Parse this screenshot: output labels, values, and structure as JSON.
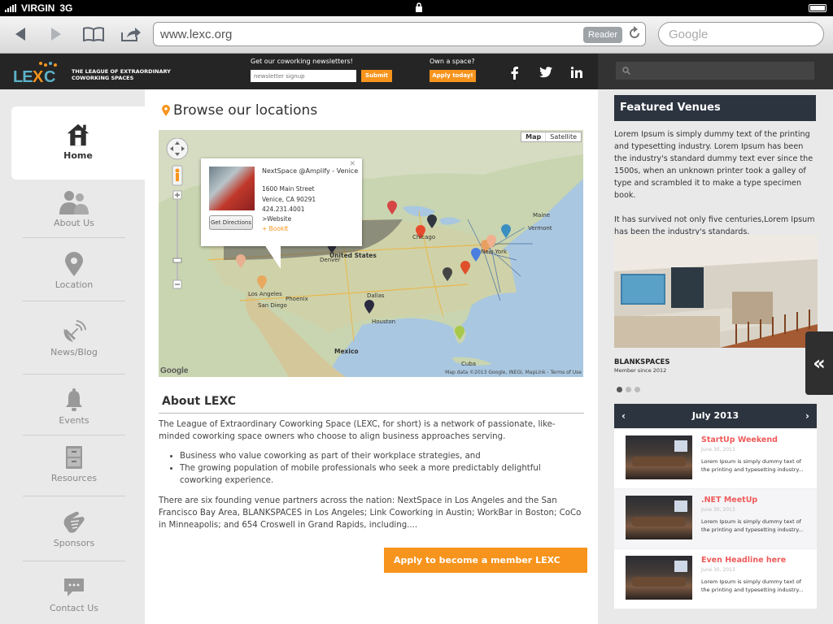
{
  "status": {
    "carrier": "VIRGIN",
    "network": "3G"
  },
  "browser": {
    "url": "www.lexc.org",
    "reader": "Reader",
    "search_placeholder": "Google"
  },
  "header": {
    "logo": "LEXC",
    "tagline": "THE LEAGUE OF EXTRAORDINARY COWORKING SPACES",
    "newsletter_label": "Get our coworking newsletters!",
    "newsletter_placeholder": "newsletter signup",
    "submit": "Submit",
    "own_label": "Own a space?",
    "apply_today": "Apply today!",
    "social": [
      "f",
      "twitter",
      "in"
    ]
  },
  "sidebar": {
    "items": [
      {
        "label": "Home",
        "icon": "home-icon"
      },
      {
        "label": "About Us",
        "icon": "people-icon"
      },
      {
        "label": "Location",
        "icon": "location-pin-icon"
      },
      {
        "label": "News/Blog",
        "icon": "satellite-dish-icon"
      },
      {
        "label": "Events",
        "icon": "bell-icon"
      },
      {
        "label": "Resources",
        "icon": "cabinet-icon"
      },
      {
        "label": "Sponsors",
        "icon": "handshake-icon"
      },
      {
        "label": "Contact Us",
        "icon": "chat-bubble-icon"
      }
    ]
  },
  "main": {
    "title": "Browse our locations",
    "map": {
      "type_map": "Map",
      "type_satellite": "Satellite",
      "google": "Google",
      "copyright": "Map data ©2013 Google, INEGI, MapLink - Terms of Use",
      "popup": {
        "name": "NextSpace @Amplify - Venice",
        "street": "1600 Main Street",
        "city": "Venice, CA 90291",
        "phone": "424.231.4001",
        "website": ">Website",
        "bookit": "+ BookIt",
        "directions": "Get Directions"
      },
      "labels": [
        "United States",
        "Mexico",
        "Cuba",
        "Chicago",
        "New York",
        "Houston",
        "Dallas",
        "Phoenix",
        "Denver",
        "Los Angeles",
        "San Diego",
        "Vermont",
        "Maine"
      ]
    },
    "about": {
      "title": "About LEXC",
      "p1": "The League of Extraordinary Coworking Space (LEXC, for short) is a network of passionate, like-minded coworking space owners who choose to align business approaches serving.",
      "bullets": [
        "Business who value coworking as part of their workplace strategies, and",
        "The growing population of mobile professionals who seek a more predictably delightful coworking experience."
      ],
      "p2": "There are six founding venue partners across the nation: NextSpace in Los Angeles and the San Francisco  Bay Area, BLANKSPACES in Los Angeles; Link Coworking in Austin; WorkBar in Boston; CoCo in Minneapolis; and 654  Croswell in Grand Rapids, including....",
      "apply_button": "Apply to become a member LEXC space"
    }
  },
  "right": {
    "featured_title": "Featured Venues",
    "featured_p1": "Lorem Ipsum is simply dummy text of the printing and typesetting industry. Lorem Ipsum has been the industry's standard dummy text ever since the 1500s, when an unknown printer took a galley of type and scrambled it to make a type specimen book.",
    "featured_p2": "It has survived not only five centuries,Lorem Ipsum has been the industry's standards.",
    "venue_name": "BLANKSPACES",
    "venue_since": "Member since 2012",
    "calendar_month": "July 2013",
    "events": [
      {
        "title": "StartUp Weekend",
        "date": "June 30, 2013",
        "text": "Lorem Ipsum is simply dummy text of the printing and typesetting industry..."
      },
      {
        "title": ".NET MeetUp",
        "date": "June 30, 2013",
        "text": "Lorem Ipsum is simply dummy text of the printing and typesetting industry..."
      },
      {
        "title": "Even Headline here",
        "date": "June 30, 2013",
        "text": "Lorem Ipsum is simply dummy text of the printing and typesetting industry..."
      }
    ]
  },
  "colors": {
    "accent": "#f7941d",
    "dark_header": "#252525",
    "navy": "#2c3440",
    "event_title": "#f05a5a"
  }
}
